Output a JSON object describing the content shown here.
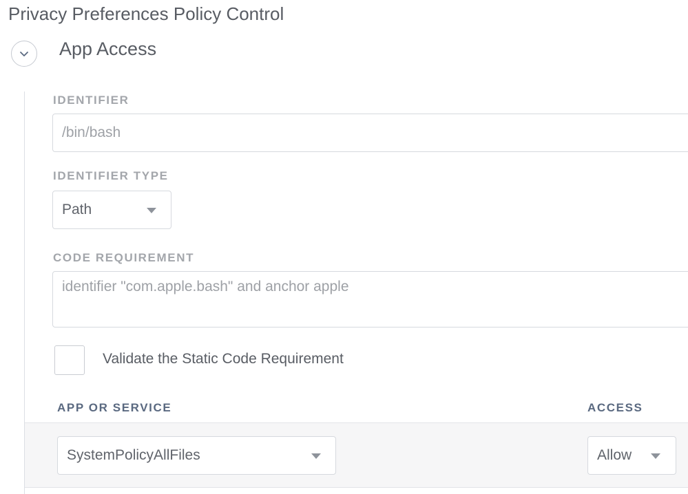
{
  "page": {
    "title": "Privacy Preferences Policy Control"
  },
  "section": {
    "title": "App Access",
    "toggle_icon": "chevron-down-icon"
  },
  "form": {
    "identifier": {
      "label": "IDENTIFIER",
      "placeholder": "/bin/bash"
    },
    "identifier_type": {
      "label": "IDENTIFIER TYPE",
      "selected": "Path"
    },
    "code_requirement": {
      "label": "CODE REQUIREMENT",
      "placeholder": "identifier \"com.apple.bash\" and anchor apple"
    },
    "validate_checkbox": {
      "label": "Validate the Static Code Requirement",
      "checked": false
    }
  },
  "table": {
    "columns": [
      "APP OR SERVICE",
      "ACCESS"
    ],
    "rows": [
      {
        "service": "SystemPolicyAllFiles",
        "access": "Allow"
      }
    ]
  },
  "colors": {
    "label_gray": "#a3a6ab",
    "header_blue_gray": "#5a6980",
    "border": "#d6d9de",
    "row_background": "#f6f6f7"
  }
}
